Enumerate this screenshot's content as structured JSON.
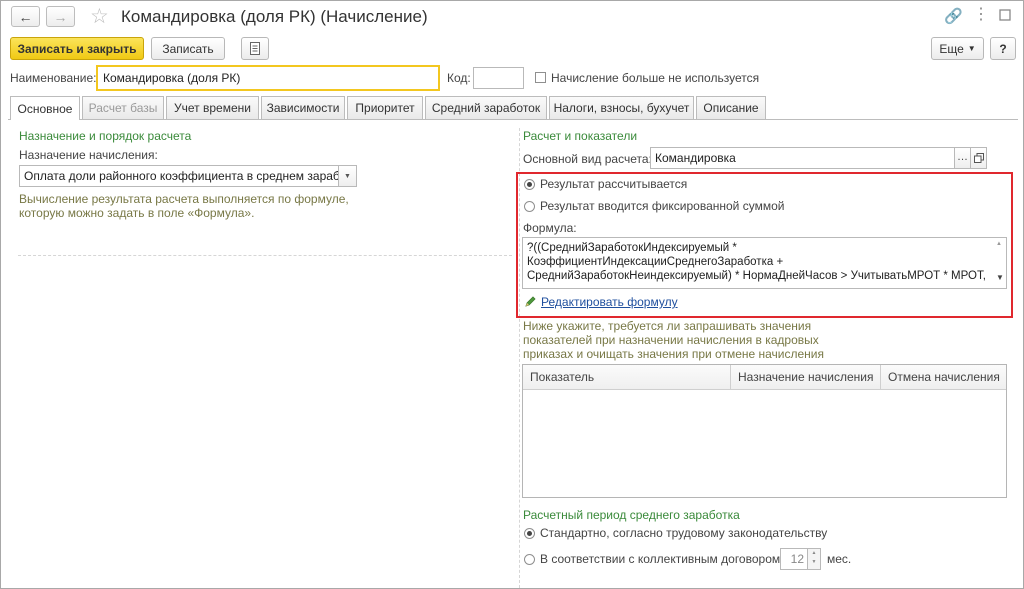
{
  "window": {
    "title": "Командировка (доля РК) (Начисление)"
  },
  "toolbar": {
    "save_close_label": "Записать и закрыть",
    "save_label": "Записать",
    "more_label": "Еще",
    "help_label": "?"
  },
  "header": {
    "name_label": "Наименование:",
    "name_value": "Командировка (доля РК)",
    "code_label": "Код:",
    "code_value": "",
    "unused_label": "Начисление больше не используется"
  },
  "tabs": [
    {
      "label": "Основное"
    },
    {
      "label": "Расчет базы"
    },
    {
      "label": "Учет времени"
    },
    {
      "label": "Зависимости"
    },
    {
      "label": "Приоритет"
    },
    {
      "label": "Средний заработок"
    },
    {
      "label": "Налоги, взносы, бухучет"
    },
    {
      "label": "Описание"
    }
  ],
  "left": {
    "section_title": "Назначение и порядок расчета",
    "purpose_label": "Назначение начисления:",
    "purpose_value": "Оплата доли районного коэффициента в среднем заработ",
    "hint_line1": "Вычисление результата расчета выполняется по формуле,",
    "hint_line2": "которую можно задать в поле «Формула»."
  },
  "right": {
    "section_title": "Расчет и показатели",
    "main_type_label": "Основной вид расчета:",
    "main_type_value": "Командировка",
    "radio_calculated": "Результат рассчитывается",
    "radio_fixed": "Результат вводится фиксированной суммой",
    "formula_label": "Формула:",
    "formula_line1": "?((СреднийЗаработокИндексируемый *",
    "formula_line2": "КоэффициентИндексацииСреднегоЗаработка +",
    "formula_line3": "СреднийЗаработокНеиндексируемый) * НормаДнейЧасов > УчитыватьМРОТ * МРОТ,",
    "edit_formula_link": "Редактировать формулу",
    "indicators_hint_1": "Ниже укажите, требуется ли запрашивать значения",
    "indicators_hint_2": "показателей при назначении начисления в кадровых",
    "indicators_hint_3": "приказах и очищать значения при отмене начисления",
    "grid_columns": [
      "Показатель",
      "Назначение начисления",
      "Отмена начисления"
    ],
    "period_title": "Расчетный период среднего заработка",
    "period_standard": "Стандартно, согласно трудовому законодательству",
    "period_contract": "В соответствии с коллективным договором",
    "period_months_value": "12",
    "period_months_unit": "мес."
  },
  "colors": {
    "accent_yellow": "#f5d321",
    "section_green": "#3a8a3a",
    "highlight_red": "#e0282e",
    "link_blue": "#1f4f9e"
  }
}
